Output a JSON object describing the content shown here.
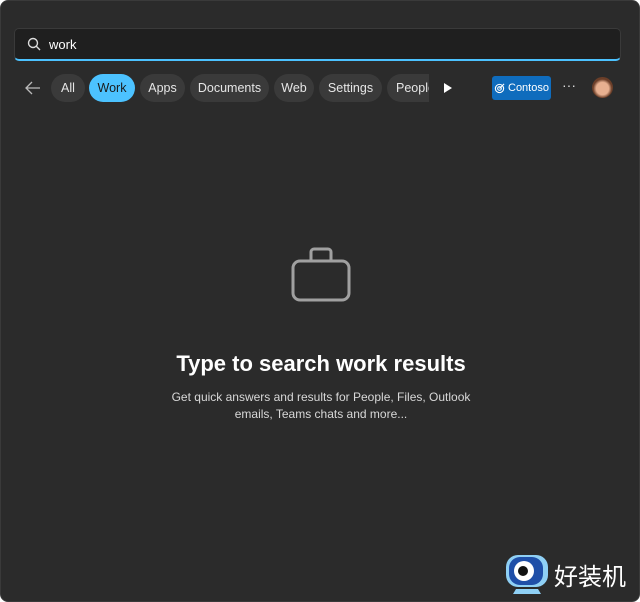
{
  "search": {
    "value": "work",
    "icon": "search-icon"
  },
  "filters": [
    {
      "label": "All",
      "active": false
    },
    {
      "label": "Work",
      "active": true
    },
    {
      "label": "Apps",
      "active": false
    },
    {
      "label": "Documents",
      "active": false
    },
    {
      "label": "Web",
      "active": false
    },
    {
      "label": "Settings",
      "active": false
    },
    {
      "label": "People",
      "active": false
    }
  ],
  "org_button": {
    "label": "Contoso"
  },
  "more_label": "···",
  "empty_state": {
    "icon": "briefcase-icon",
    "title": "Type to search work results",
    "line1": "Get quick answers and results for People, Files, Outlook",
    "line2": "emails, Teams chats and more..."
  },
  "watermark": {
    "text": "好装机"
  },
  "colors": {
    "accent": "#4cc2ff",
    "org": "#0f6cbd",
    "bg": "#2b2b2b"
  }
}
